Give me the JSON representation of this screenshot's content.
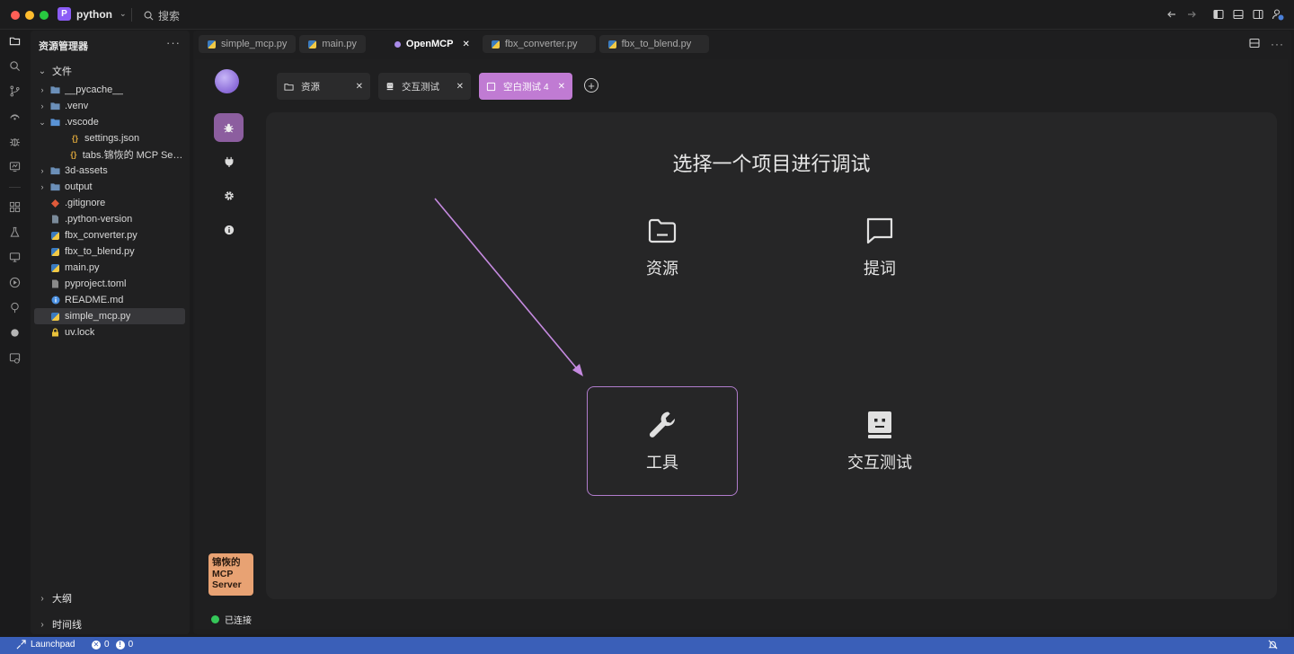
{
  "titlebar": {
    "project_initial": "P",
    "project_name": "python",
    "search_label": "搜索"
  },
  "sidebar": {
    "title": "资源管理器",
    "more": "···",
    "section_files": "文件",
    "section_outline": "大纲",
    "section_timeline": "时间线",
    "tree": [
      {
        "label": "__pycache__",
        "type": "folder",
        "depth": 0
      },
      {
        "label": ".venv",
        "type": "folder",
        "depth": 0
      },
      {
        "label": ".vscode",
        "type": "folder-open",
        "depth": 0
      },
      {
        "label": "settings.json",
        "type": "json",
        "depth": 1
      },
      {
        "label": "tabs.锦恢的 MCP Server...",
        "type": "json",
        "depth": 1
      },
      {
        "label": "3d-assets",
        "type": "folder",
        "depth": 0
      },
      {
        "label": "output",
        "type": "folder",
        "depth": 0
      },
      {
        "label": ".gitignore",
        "type": "git",
        "depth": 0
      },
      {
        "label": ".python-version",
        "type": "file",
        "depth": 0
      },
      {
        "label": "fbx_converter.py",
        "type": "py",
        "depth": 0
      },
      {
        "label": "fbx_to_blend.py",
        "type": "py",
        "depth": 0
      },
      {
        "label": "main.py",
        "type": "py",
        "depth": 0
      },
      {
        "label": "pyproject.toml",
        "type": "toml",
        "depth": 0
      },
      {
        "label": "README.md",
        "type": "md",
        "depth": 0
      },
      {
        "label": "simple_mcp.py",
        "type": "py",
        "depth": 0,
        "selected": true
      },
      {
        "label": "uv.lock",
        "type": "lock",
        "depth": 0
      }
    ]
  },
  "editor_tabs": [
    {
      "label": "simple_mcp.py",
      "active": false
    },
    {
      "label": "main.py",
      "active": false
    },
    {
      "label": "OpenMCP",
      "active": true
    },
    {
      "label": "fbx_converter.py",
      "active": false
    },
    {
      "label": "fbx_to_blend.py",
      "active": false
    }
  ],
  "openmcp": {
    "inner_tabs": [
      {
        "label": "资源",
        "active": false
      },
      {
        "label": "交互测试",
        "active": false
      },
      {
        "label": "空白测试 4",
        "active": true
      }
    ],
    "server_badge": "锦恢的 MCP Server",
    "connection_status": "已连接",
    "content_title": "选择一个项目进行调试",
    "options": [
      {
        "label": "资源",
        "icon": "folder-icon",
        "selected": false
      },
      {
        "label": "提词",
        "icon": "chat-bubble-icon",
        "selected": false
      },
      {
        "label": "工具",
        "icon": "wrench-icon",
        "selected": true
      },
      {
        "label": "交互测试",
        "icon": "robot-icon",
        "selected": false
      }
    ]
  },
  "statusbar": {
    "launchpad": "Launchpad",
    "errors": "0",
    "warnings": "0"
  },
  "colors": {
    "accent": "#c07bd3",
    "status_bar": "#3a5fb8",
    "connected": "#35c759",
    "server_badge": "#e8a273"
  }
}
